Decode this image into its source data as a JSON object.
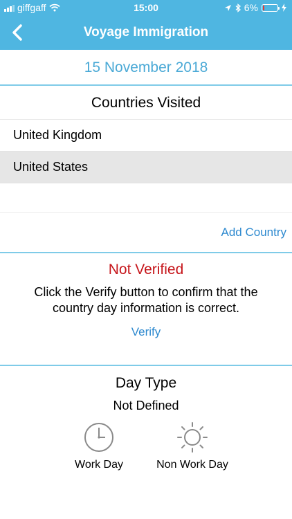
{
  "status_bar": {
    "carrier": "giffgaff",
    "time": "15:00",
    "battery_percent": "6%",
    "battery_level": 0.06
  },
  "nav": {
    "title": "Voyage Immigration",
    "back_icon": "chevron-left-icon"
  },
  "date": "15 November 2018",
  "countries": {
    "title": "Countries Visited",
    "items": [
      {
        "label": "United Kingdom",
        "selected": false
      },
      {
        "label": "United States",
        "selected": true
      }
    ],
    "add_label": "Add Country"
  },
  "verification": {
    "status": "Not Verified",
    "description": "Click the Verify button to confirm that the country day information is correct.",
    "verify_label": "Verify"
  },
  "day_type": {
    "title": "Day Type",
    "value": "Not Defined",
    "options": [
      {
        "label": "Work Day",
        "icon": "clock-icon"
      },
      {
        "label": "Non Work Day",
        "icon": "sun-icon"
      }
    ]
  },
  "colors": {
    "header": "#4fb6e1",
    "date_text": "#4aa9d6",
    "link": "#2d89cf",
    "not_verified": "#c6161b",
    "selected_row": "#e6e6e6",
    "battery_low": "#e53935"
  }
}
